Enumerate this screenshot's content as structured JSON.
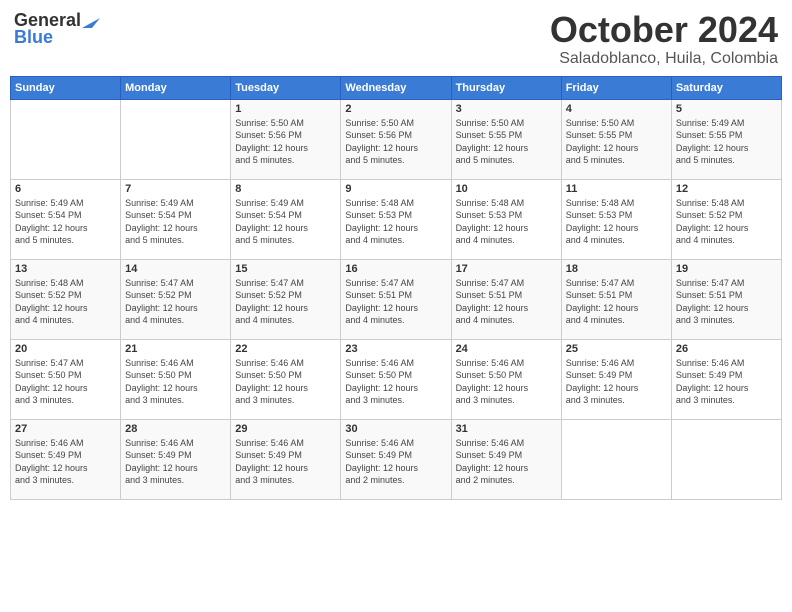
{
  "logo": {
    "general": "General",
    "blue": "Blue"
  },
  "title": {
    "month": "October 2024",
    "location": "Saladoblanco, Huila, Colombia"
  },
  "headers": [
    "Sunday",
    "Monday",
    "Tuesday",
    "Wednesday",
    "Thursday",
    "Friday",
    "Saturday"
  ],
  "weeks": [
    [
      {
        "day": "",
        "content": ""
      },
      {
        "day": "",
        "content": ""
      },
      {
        "day": "1",
        "content": "Sunrise: 5:50 AM\nSunset: 5:56 PM\nDaylight: 12 hours\nand 5 minutes."
      },
      {
        "day": "2",
        "content": "Sunrise: 5:50 AM\nSunset: 5:56 PM\nDaylight: 12 hours\nand 5 minutes."
      },
      {
        "day": "3",
        "content": "Sunrise: 5:50 AM\nSunset: 5:55 PM\nDaylight: 12 hours\nand 5 minutes."
      },
      {
        "day": "4",
        "content": "Sunrise: 5:50 AM\nSunset: 5:55 PM\nDaylight: 12 hours\nand 5 minutes."
      },
      {
        "day": "5",
        "content": "Sunrise: 5:49 AM\nSunset: 5:55 PM\nDaylight: 12 hours\nand 5 minutes."
      }
    ],
    [
      {
        "day": "6",
        "content": "Sunrise: 5:49 AM\nSunset: 5:54 PM\nDaylight: 12 hours\nand 5 minutes."
      },
      {
        "day": "7",
        "content": "Sunrise: 5:49 AM\nSunset: 5:54 PM\nDaylight: 12 hours\nand 5 minutes."
      },
      {
        "day": "8",
        "content": "Sunrise: 5:49 AM\nSunset: 5:54 PM\nDaylight: 12 hours\nand 5 minutes."
      },
      {
        "day": "9",
        "content": "Sunrise: 5:48 AM\nSunset: 5:53 PM\nDaylight: 12 hours\nand 4 minutes."
      },
      {
        "day": "10",
        "content": "Sunrise: 5:48 AM\nSunset: 5:53 PM\nDaylight: 12 hours\nand 4 minutes."
      },
      {
        "day": "11",
        "content": "Sunrise: 5:48 AM\nSunset: 5:53 PM\nDaylight: 12 hours\nand 4 minutes."
      },
      {
        "day": "12",
        "content": "Sunrise: 5:48 AM\nSunset: 5:52 PM\nDaylight: 12 hours\nand 4 minutes."
      }
    ],
    [
      {
        "day": "13",
        "content": "Sunrise: 5:48 AM\nSunset: 5:52 PM\nDaylight: 12 hours\nand 4 minutes."
      },
      {
        "day": "14",
        "content": "Sunrise: 5:47 AM\nSunset: 5:52 PM\nDaylight: 12 hours\nand 4 minutes."
      },
      {
        "day": "15",
        "content": "Sunrise: 5:47 AM\nSunset: 5:52 PM\nDaylight: 12 hours\nand 4 minutes."
      },
      {
        "day": "16",
        "content": "Sunrise: 5:47 AM\nSunset: 5:51 PM\nDaylight: 12 hours\nand 4 minutes."
      },
      {
        "day": "17",
        "content": "Sunrise: 5:47 AM\nSunset: 5:51 PM\nDaylight: 12 hours\nand 4 minutes."
      },
      {
        "day": "18",
        "content": "Sunrise: 5:47 AM\nSunset: 5:51 PM\nDaylight: 12 hours\nand 4 minutes."
      },
      {
        "day": "19",
        "content": "Sunrise: 5:47 AM\nSunset: 5:51 PM\nDaylight: 12 hours\nand 3 minutes."
      }
    ],
    [
      {
        "day": "20",
        "content": "Sunrise: 5:47 AM\nSunset: 5:50 PM\nDaylight: 12 hours\nand 3 minutes."
      },
      {
        "day": "21",
        "content": "Sunrise: 5:46 AM\nSunset: 5:50 PM\nDaylight: 12 hours\nand 3 minutes."
      },
      {
        "day": "22",
        "content": "Sunrise: 5:46 AM\nSunset: 5:50 PM\nDaylight: 12 hours\nand 3 minutes."
      },
      {
        "day": "23",
        "content": "Sunrise: 5:46 AM\nSunset: 5:50 PM\nDaylight: 12 hours\nand 3 minutes."
      },
      {
        "day": "24",
        "content": "Sunrise: 5:46 AM\nSunset: 5:50 PM\nDaylight: 12 hours\nand 3 minutes."
      },
      {
        "day": "25",
        "content": "Sunrise: 5:46 AM\nSunset: 5:49 PM\nDaylight: 12 hours\nand 3 minutes."
      },
      {
        "day": "26",
        "content": "Sunrise: 5:46 AM\nSunset: 5:49 PM\nDaylight: 12 hours\nand 3 minutes."
      }
    ],
    [
      {
        "day": "27",
        "content": "Sunrise: 5:46 AM\nSunset: 5:49 PM\nDaylight: 12 hours\nand 3 minutes."
      },
      {
        "day": "28",
        "content": "Sunrise: 5:46 AM\nSunset: 5:49 PM\nDaylight: 12 hours\nand 3 minutes."
      },
      {
        "day": "29",
        "content": "Sunrise: 5:46 AM\nSunset: 5:49 PM\nDaylight: 12 hours\nand 3 minutes."
      },
      {
        "day": "30",
        "content": "Sunrise: 5:46 AM\nSunset: 5:49 PM\nDaylight: 12 hours\nand 2 minutes."
      },
      {
        "day": "31",
        "content": "Sunrise: 5:46 AM\nSunset: 5:49 PM\nDaylight: 12 hours\nand 2 minutes."
      },
      {
        "day": "",
        "content": ""
      },
      {
        "day": "",
        "content": ""
      }
    ]
  ]
}
